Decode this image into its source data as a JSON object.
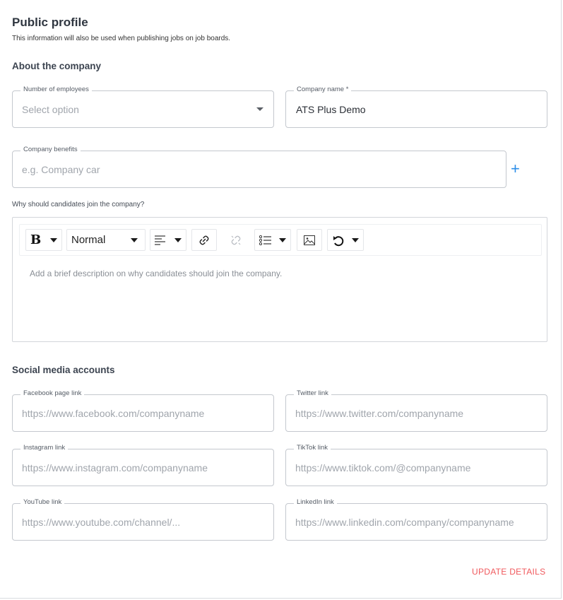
{
  "header": {
    "title": "Public profile",
    "subtitle": "This information will also be used when publishing jobs on job boards."
  },
  "about": {
    "heading": "About the company",
    "employees": {
      "label": "Number of employees",
      "placeholder": "Select option"
    },
    "company_name": {
      "label": "Company name *",
      "value": "ATS Plus Demo"
    },
    "benefits": {
      "label": "Company benefits",
      "placeholder": "e.g. Company car"
    },
    "add_icon": "plus-icon"
  },
  "why": {
    "label": "Why should candidates join the company?",
    "toolbar": {
      "bold_icon": "B",
      "format_value": "Normal",
      "icons": [
        "bold-icon",
        "align-icon",
        "link-icon",
        "unlink-icon",
        "list-icon",
        "image-icon",
        "undo-icon"
      ]
    },
    "placeholder": "Add a brief description on why candidates should join the company."
  },
  "social": {
    "heading": "Social media accounts",
    "facebook": {
      "label": "Facebook page link",
      "placeholder": "https://www.facebook.com/companyname"
    },
    "twitter": {
      "label": "Twitter link",
      "placeholder": "https://www.twitter.com/companyname"
    },
    "instagram": {
      "label": "Instagram link",
      "placeholder": "https://www.instagram.com/companyname"
    },
    "tiktok": {
      "label": "TikTok link",
      "placeholder": "https://www.tiktok.com/@companyname"
    },
    "youtube": {
      "label": "YouTube link",
      "placeholder": "https://www.youtube.com/channel/..."
    },
    "linkedin": {
      "label": "LinkedIn link",
      "placeholder": "https://www.linkedin.com/company/companyname"
    }
  },
  "actions": {
    "update_label": "UPDATE DETAILS"
  },
  "colors": {
    "accent_blue": "#2d8ee8",
    "update_red": "#f0595d"
  }
}
